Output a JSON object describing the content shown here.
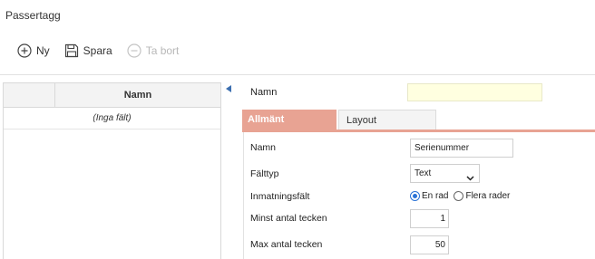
{
  "page": {
    "title": "Passertagg"
  },
  "toolbar": {
    "new_label": "Ny",
    "save_label": "Spara",
    "delete_label": "Ta bort"
  },
  "grid": {
    "column_header": "Namn",
    "empty_text": "(Inga fält)"
  },
  "top_form": {
    "name_label": "Namn",
    "name_value": ""
  },
  "tabs": [
    {
      "label": "Allmänt",
      "active": true
    },
    {
      "label": "Layout",
      "active": false
    }
  ],
  "form": {
    "name_label": "Namn",
    "name_value": "Serienummer",
    "fieldtype_label": "Fälttyp",
    "fieldtype_value": "Text",
    "input_label": "Inmatningsfält",
    "input_options": [
      "En rad",
      "Flera rader"
    ],
    "input_selected": "En rad",
    "min_label": "Minst antal tecken",
    "min_value": "1",
    "max_label": "Max antal tecken",
    "max_value": "50"
  },
  "colors": {
    "accent_tab": "#e8a393",
    "required_field": "#ffffe0",
    "radio_selected": "#2b73d6"
  }
}
